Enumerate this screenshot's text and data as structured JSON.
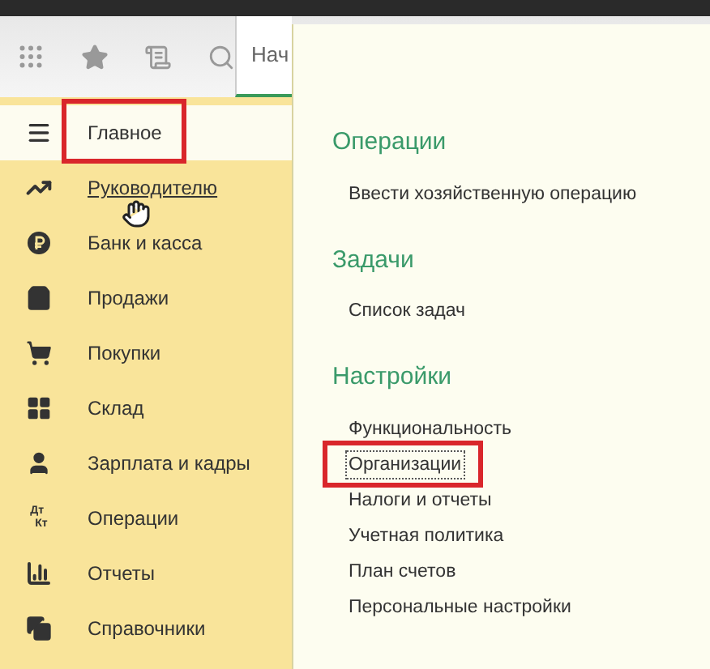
{
  "toolbar": {
    "tab": {
      "label": "Нач",
      "selected": true
    }
  },
  "sidebar": {
    "items": [
      {
        "label": "Главное",
        "selected": true,
        "hovered": false,
        "highlighted": true
      },
      {
        "label": "Руководителю",
        "selected": false,
        "hovered": true,
        "highlighted": false
      },
      {
        "label": "Банк и касса",
        "selected": false,
        "hovered": false,
        "highlighted": false
      },
      {
        "label": "Продажи",
        "selected": false,
        "hovered": false,
        "highlighted": false
      },
      {
        "label": "Покупки",
        "selected": false,
        "hovered": false,
        "highlighted": false
      },
      {
        "label": "Склад",
        "selected": false,
        "hovered": false,
        "highlighted": false
      },
      {
        "label": "Зарплата и кадры",
        "selected": false,
        "hovered": false,
        "highlighted": false
      },
      {
        "label": "Операции",
        "selected": false,
        "hovered": false,
        "highlighted": false,
        "icon_text": [
          "Дт",
          "Кт"
        ]
      },
      {
        "label": "Отчеты",
        "selected": false,
        "hovered": false,
        "highlighted": false
      },
      {
        "label": "Справочники",
        "selected": false,
        "hovered": false,
        "highlighted": false
      }
    ]
  },
  "panel": {
    "sections": [
      {
        "title": "Операции",
        "items": [
          {
            "label": "Ввести хозяйственную операцию",
            "focused": false,
            "highlighted": false
          }
        ]
      },
      {
        "title": "Задачи",
        "items": [
          {
            "label": "Список задач",
            "focused": false,
            "highlighted": false
          }
        ]
      },
      {
        "title": "Настройки",
        "items": [
          {
            "label": "Функциональность",
            "focused": false,
            "highlighted": false
          },
          {
            "label": "Организации",
            "focused": true,
            "highlighted": true
          },
          {
            "label": "Налоги и отчеты",
            "focused": false,
            "highlighted": false
          },
          {
            "label": "Учетная политика",
            "focused": false,
            "highlighted": false
          },
          {
            "label": "План счетов",
            "focused": false,
            "highlighted": false
          },
          {
            "label": "Персональные настройки",
            "focused": false,
            "highlighted": false
          }
        ]
      }
    ]
  }
}
